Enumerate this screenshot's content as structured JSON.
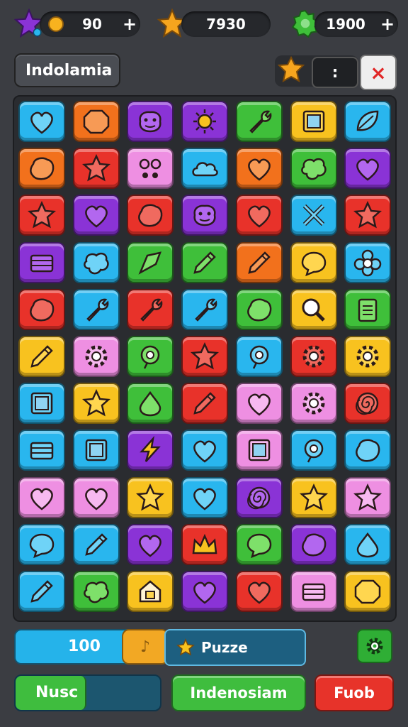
{
  "topbar": {
    "coins": {
      "value": "90",
      "plus": "+"
    },
    "stars": {
      "value": "7930"
    },
    "gems": {
      "value": "1900",
      "plus": "+"
    }
  },
  "title": "Indolamia",
  "pause_label": ":",
  "close_label": "×",
  "score": {
    "value": "100",
    "tag": "♪"
  },
  "puzzle_label": "Puzze",
  "progress": {
    "label": "Nusc",
    "fraction": 0.48
  },
  "green_button": "Indenosiam",
  "red_button": "Fuob",
  "colors": {
    "red": "#e8322a",
    "orange": "#f2711c",
    "yellow": "#f8c21f",
    "green": "#3fbf3a",
    "cyan": "#29b6ee",
    "purple": "#8a33d6",
    "pink": "#ee8fe2"
  },
  "grid": [
    [
      {
        "color": "cyan",
        "icon": "heart-icon"
      },
      {
        "color": "orange",
        "icon": "octagon-icon"
      },
      {
        "color": "purple",
        "icon": "monster-icon"
      },
      {
        "color": "purple",
        "icon": "sun-icon"
      },
      {
        "color": "green",
        "icon": "wrench-icon"
      },
      {
        "color": "yellow",
        "icon": "picture-icon"
      },
      {
        "color": "cyan",
        "icon": "leaf-icon"
      }
    ],
    [
      {
        "color": "orange",
        "icon": "blob-icon"
      },
      {
        "color": "red",
        "icon": "star-icon"
      },
      {
        "color": "pink",
        "icon": "face-icon"
      },
      {
        "color": "cyan",
        "icon": "cloud-icon"
      },
      {
        "color": "orange",
        "icon": "heart-icon"
      },
      {
        "color": "green",
        "icon": "splat-icon"
      },
      {
        "color": "purple",
        "icon": "heart-icon"
      }
    ],
    [
      {
        "color": "red",
        "icon": "star-icon"
      },
      {
        "color": "purple",
        "icon": "heart-icon"
      },
      {
        "color": "red",
        "icon": "blob-icon"
      },
      {
        "color": "purple",
        "icon": "monster-icon"
      },
      {
        "color": "red",
        "icon": "heart-icon"
      },
      {
        "color": "cyan",
        "icon": "tools-icon"
      },
      {
        "color": "red",
        "icon": "star-icon"
      }
    ],
    [
      {
        "color": "purple",
        "icon": "box-icon"
      },
      {
        "color": "cyan",
        "icon": "splat-icon"
      },
      {
        "color": "green",
        "icon": "arrow-icon"
      },
      {
        "color": "green",
        "icon": "crayon-icon"
      },
      {
        "color": "orange",
        "icon": "crayon-icon"
      },
      {
        "color": "yellow",
        "icon": "bubble-icon"
      },
      {
        "color": "cyan",
        "icon": "flower-icon"
      }
    ],
    [
      {
        "color": "red",
        "icon": "blob-icon"
      },
      {
        "color": "cyan",
        "icon": "wrench-icon"
      },
      {
        "color": "red",
        "icon": "wrench-icon"
      },
      {
        "color": "cyan",
        "icon": "wrench-icon"
      },
      {
        "color": "green",
        "icon": "blob-icon"
      },
      {
        "color": "yellow",
        "icon": "magnifier-icon"
      },
      {
        "color": "green",
        "icon": "clipboard-icon"
      }
    ],
    [
      {
        "color": "yellow",
        "icon": "crayon-icon"
      },
      {
        "color": "pink",
        "icon": "gear-icon"
      },
      {
        "color": "green",
        "icon": "target-icon"
      },
      {
        "color": "red",
        "icon": "star-icon"
      },
      {
        "color": "cyan",
        "icon": "target-icon"
      },
      {
        "color": "red",
        "icon": "gear-icon"
      },
      {
        "color": "yellow",
        "icon": "gear-icon"
      }
    ],
    [
      {
        "color": "cyan",
        "icon": "picture-icon"
      },
      {
        "color": "yellow",
        "icon": "star-icon"
      },
      {
        "color": "green",
        "icon": "drop-icon"
      },
      {
        "color": "red",
        "icon": "crayon-icon"
      },
      {
        "color": "pink",
        "icon": "heart-icon"
      },
      {
        "color": "pink",
        "icon": "gear-icon"
      },
      {
        "color": "red",
        "icon": "swirl-icon"
      }
    ],
    [
      {
        "color": "cyan",
        "icon": "box-icon"
      },
      {
        "color": "cyan",
        "icon": "picture-icon"
      },
      {
        "color": "purple",
        "icon": "bolt-icon"
      },
      {
        "color": "cyan",
        "icon": "heart-icon"
      },
      {
        "color": "pink",
        "icon": "picture-icon"
      },
      {
        "color": "cyan",
        "icon": "target-icon"
      },
      {
        "color": "cyan",
        "icon": "blob-icon"
      }
    ],
    [
      {
        "color": "pink",
        "icon": "heart-icon"
      },
      {
        "color": "pink",
        "icon": "heart-icon"
      },
      {
        "color": "yellow",
        "icon": "star-icon"
      },
      {
        "color": "cyan",
        "icon": "heart-icon"
      },
      {
        "color": "purple",
        "icon": "swirl-icon"
      },
      {
        "color": "yellow",
        "icon": "star-icon"
      },
      {
        "color": "pink",
        "icon": "star-icon"
      }
    ],
    [
      {
        "color": "cyan",
        "icon": "bubble-icon"
      },
      {
        "color": "cyan",
        "icon": "crayon-icon"
      },
      {
        "color": "purple",
        "icon": "heart-icon"
      },
      {
        "color": "red",
        "icon": "crown-icon"
      },
      {
        "color": "green",
        "icon": "bubble-icon"
      },
      {
        "color": "purple",
        "icon": "blob-icon"
      },
      {
        "color": "cyan",
        "icon": "drop-icon"
      }
    ],
    [
      {
        "color": "cyan",
        "icon": "crayon-icon"
      },
      {
        "color": "green",
        "icon": "splat-icon"
      },
      {
        "color": "yellow",
        "icon": "house-icon"
      },
      {
        "color": "purple",
        "icon": "heart-icon"
      },
      {
        "color": "red",
        "icon": "heart-icon"
      },
      {
        "color": "pink",
        "icon": "box-icon"
      },
      {
        "color": "yellow",
        "icon": "octagon-icon"
      }
    ]
  ]
}
